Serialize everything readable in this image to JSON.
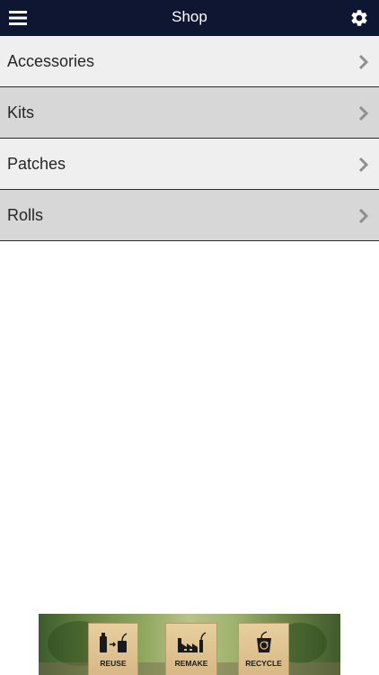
{
  "header": {
    "title": "Shop",
    "menu_icon": "hamburger-menu-icon",
    "settings_icon": "gear-icon",
    "background_color": "#0e1631"
  },
  "categories": [
    {
      "label": "Accessories"
    },
    {
      "label": "Kits"
    },
    {
      "label": "Patches"
    },
    {
      "label": "Rolls"
    }
  ],
  "ad": {
    "blocks": [
      {
        "label": "REUSE",
        "icon": "bottle-jar-icon"
      },
      {
        "label": "REMAKE",
        "icon": "factory-icon"
      },
      {
        "label": "RECYCLE",
        "icon": "recycle-bin-icon"
      }
    ]
  }
}
